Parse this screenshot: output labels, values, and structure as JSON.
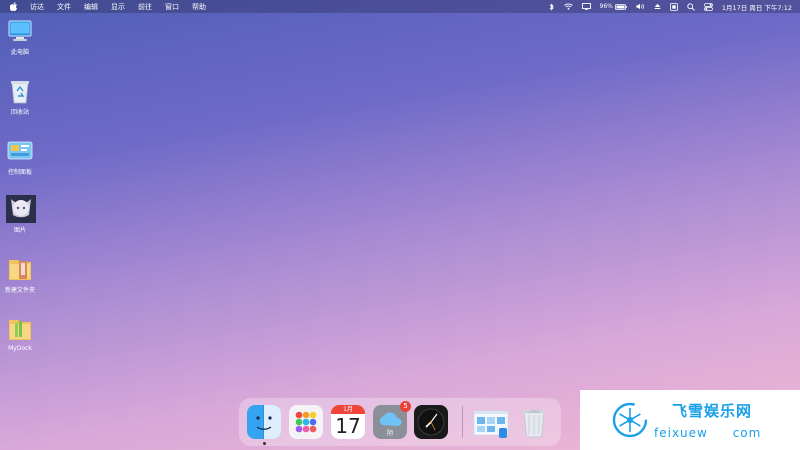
{
  "menubar": {
    "apple_icon": "apple-icon",
    "items": [
      "访达",
      "文件",
      "编辑",
      "显示",
      "前往",
      "窗口",
      "帮助"
    ],
    "battery_percent": "96%",
    "datetime": "1月17日 周日 下午7:12"
  },
  "desktop": {
    "icons": [
      {
        "label": "此电脑",
        "icon": "computer-icon"
      },
      {
        "label": "回收站",
        "icon": "recycle-bin-icon"
      },
      {
        "label": "控制面板",
        "icon": "control-panel-icon"
      },
      {
        "label": "图片",
        "icon": "anime-picture-icon"
      },
      {
        "label": "新建文件夹",
        "icon": "folder-icon"
      },
      {
        "label": "MyDock",
        "icon": "mydock-icon"
      }
    ]
  },
  "dock": {
    "calendar": {
      "month": "1月",
      "day": "17"
    },
    "weather": {
      "label": "阴",
      "badge": "5"
    }
  },
  "watermark": {
    "title": "飞雪娱乐网",
    "url_a": "feixuew",
    "url_b": "com"
  },
  "colors": {
    "accent_blue": "#1aa0e8",
    "badge_red": "#e8423a",
    "calendar_red": "#f0453a"
  }
}
